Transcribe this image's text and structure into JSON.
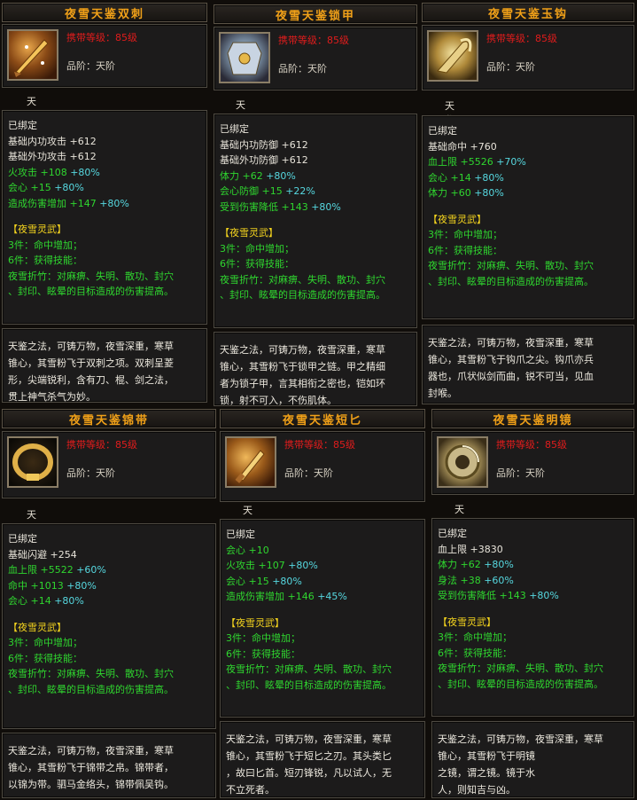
{
  "common": {
    "level_label": "携带等级：85级",
    "grade_label": "品阶：天阶",
    "sub_label": "天鉴灵武",
    "bound": "已绑定",
    "set_name": "【夜雪灵武】",
    "set3": "3件：命中增加；",
    "set6": "6件：获得技能：",
    "skill1": "夜雪折竹：对麻痹、失明、散功、封穴",
    "skill2": "、封印、眩晕的目标造成的伤害提高。"
  },
  "cards": [
    {
      "title": "夜雪天鉴双刺",
      "icon": "dual-daggers-icon",
      "stats": [
        {
          "name": "基础内功攻击",
          "val": "+612",
          "pct": ""
        },
        {
          "name": "基础外功攻击",
          "val": "+612",
          "pct": ""
        },
        {
          "name": "火攻击",
          "val": "+108",
          "pct": "+80%"
        },
        {
          "name": "会心",
          "val": "+15",
          "pct": "+80%"
        },
        {
          "name": "造成伤害增加",
          "val": "+147",
          "pct": "+80%"
        }
      ],
      "desc": [
        "天鉴之法，可铸万物，夜雪深重，寒草",
        "锥心，其雪粉飞于双刺之项。双刺呈菱",
        "形，尖端锐利，含有刀、棍、剑之法，",
        "贯上神气杀气为妙。"
      ]
    },
    {
      "title": "夜雪天鉴锁甲",
      "icon": "chain-armor-icon",
      "stats": [
        {
          "name": "基础内功防御",
          "val": "+612",
          "pct": ""
        },
        {
          "name": "基础外功防御",
          "val": "+612",
          "pct": ""
        },
        {
          "name": "体力",
          "val": "+62",
          "pct": "+80%"
        },
        {
          "name": "会心防御",
          "val": "+15",
          "pct": "+22%"
        },
        {
          "name": "受到伤害降低",
          "val": "+143",
          "pct": "+80%"
        }
      ],
      "desc": [
        "天鉴之法，可铸万物，夜雪深重，寒草",
        "锥心，其雪粉飞于锁甲之链。甲之精细",
        "者为锁子甲，言其相衔之密也，铠如环",
        "锁，射不可入，不伤肌体。"
      ]
    },
    {
      "title": "夜雪天鉴玉钩",
      "icon": "jade-hook-icon",
      "stats": [
        {
          "name": "基础命中",
          "val": "+760",
          "pct": ""
        },
        {
          "name": "血上限",
          "val": "+5526",
          "pct": "+70%"
        },
        {
          "name": "会心",
          "val": "+14",
          "pct": "+80%"
        },
        {
          "name": "体力",
          "val": "+60",
          "pct": "+80%"
        }
      ],
      "desc": [
        "天鉴之法，可铸万物，夜雪深重，寒草",
        "锥心，其雪粉飞于钩爪之尖。钩爪亦兵",
        "器也，爪状似剑而曲，锐不可当，见血",
        "封喉。"
      ]
    },
    {
      "title": "夜雪天鉴锦带",
      "icon": "brocade-belt-icon",
      "stats": [
        {
          "name": "基础闪避",
          "val": "+254",
          "pct": ""
        },
        {
          "name": "血上限",
          "val": "+5522",
          "pct": "+60%"
        },
        {
          "name": "命中",
          "val": "+1013",
          "pct": "+80%"
        },
        {
          "name": "会心",
          "val": "+14",
          "pct": "+80%"
        }
      ],
      "desc": [
        "天鉴之法，可铸万物，夜雪深重，寒草",
        "锥心，其雪粉飞于锦带之帛。锦带者，",
        "以锦为带。驷马金络头，锦带佩吴钩。"
      ]
    },
    {
      "title": "夜雪天鉴短匕",
      "icon": "short-dagger-icon",
      "stats": [
        {
          "name": "会心",
          "val": "+10",
          "pct": ""
        },
        {
          "name": "火攻击",
          "val": "+107",
          "pct": "+80%"
        },
        {
          "name": "会心",
          "val": "+15",
          "pct": "+80%"
        },
        {
          "name": "造成伤害增加",
          "val": "+146",
          "pct": "+45%"
        }
      ],
      "desc": [
        "天鉴之法，可铸万物，夜雪深重，寒草",
        "锥心，其雪粉飞于短匕之刃。其头类匕",
        "，故曰匕首。短刃锋锐，凡以试人，无",
        "不立死者。"
      ]
    },
    {
      "title": "夜雪天鉴明镜",
      "icon": "bright-mirror-icon",
      "stats": [
        {
          "name": "血上限",
          "val": "+3830",
          "pct": ""
        },
        {
          "name": "体力",
          "val": "+62",
          "pct": "+80%"
        },
        {
          "name": "身法",
          "val": "+38",
          "pct": "+60%"
        },
        {
          "name": "受到伤害降低",
          "val": "+143",
          "pct": "+80%"
        }
      ],
      "desc": [
        "天鉴之法，可铸万物，夜雪深重，寒草",
        "锥心，其雪粉飞于明镜",
        "之镜，谓之镜。镜于水",
        "人，则知吉与凶。"
      ]
    }
  ]
}
